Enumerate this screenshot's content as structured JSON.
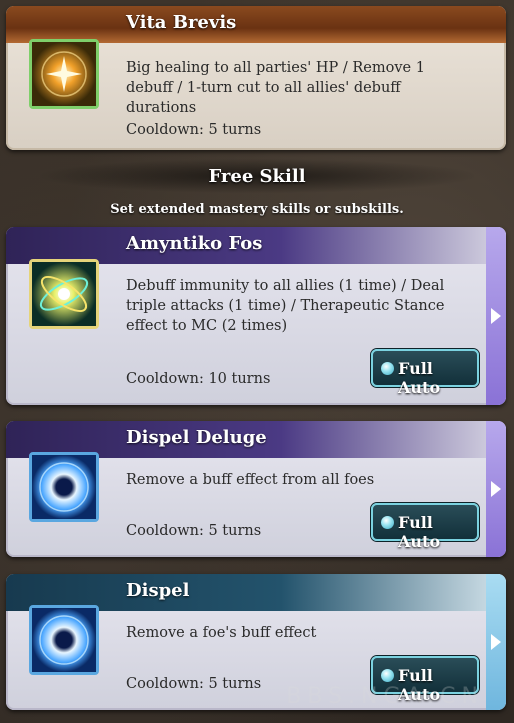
{
  "skills_top": {
    "title": "Vita Brevis",
    "description": "Big healing to all parties' HP / Remove 1 debuff / 1-turn cut to all allies' debuff durations",
    "cooldown": "Cooldown: 5 turns",
    "icon": "healing-sparkle-icon"
  },
  "free_skill": {
    "title": "Free Skill",
    "subtitle": "Set extended mastery skills or subskills."
  },
  "subskills": [
    {
      "title": "Amyntiko Fos",
      "description": "Debuff immunity to all allies (1 time) / Deal triple attacks (1 time) / Therapeutic Stance effect to MC (2 times)",
      "cooldown": "Cooldown: 10 turns",
      "full_auto_label": "Full Auto",
      "icon": "light-orbit-icon"
    },
    {
      "title": "Dispel Deluge",
      "description": "Remove a buff effect from all foes",
      "cooldown": "Cooldown: 5 turns",
      "full_auto_label": "Full Auto",
      "icon": "dispel-orb-icon"
    },
    {
      "title": "Dispel",
      "description": "Remove a foe's buff effect",
      "cooldown": "Cooldown: 5 turns",
      "full_auto_label": "Full Auto",
      "icon": "dispel-orb-icon"
    }
  ],
  "watermark": "BBS.NGA.CN",
  "colors": {
    "brown_header": "#6a3212",
    "purple_header": "#3a2b6a",
    "teal_header": "#1c4a60",
    "full_auto_border": "#7bd2e0"
  }
}
